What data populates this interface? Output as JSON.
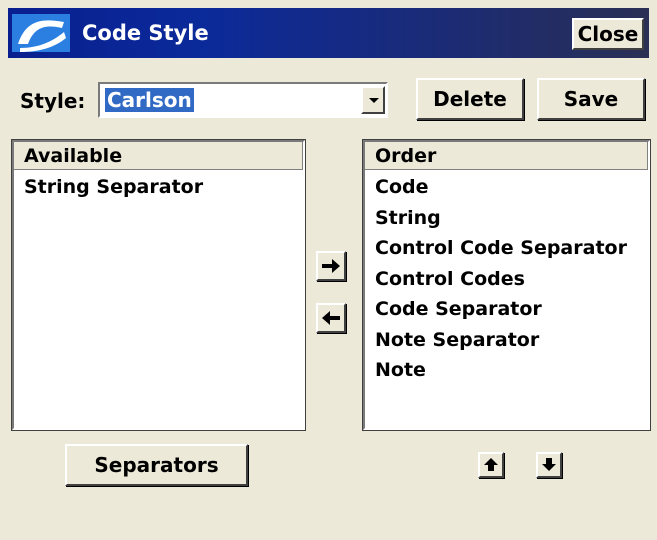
{
  "window": {
    "title": "Code Style",
    "close_label": "Close",
    "titlebar_color_start": "#0a1f8f",
    "titlebar_color_end": "#2a2f55"
  },
  "style_row": {
    "label": "Style:",
    "selected_value": "Carlson",
    "delete_label": "Delete",
    "save_label": "Save",
    "dropdown_icon": "chevron-down-icon"
  },
  "available": {
    "header": "Available",
    "items": [
      "String Separator"
    ]
  },
  "order": {
    "header": "Order",
    "items": [
      "Code",
      "String",
      "Control Code Separator",
      "Control Codes",
      "Code Separator",
      "Note Separator",
      "Note"
    ]
  },
  "controls": {
    "move_right_icon": "arrow-right-icon",
    "move_left_icon": "arrow-left-icon",
    "move_up_icon": "arrow-up-icon",
    "move_down_icon": "arrow-down-icon",
    "separators_label": "Separators"
  },
  "colors": {
    "dialog_bg": "#ece9d8",
    "selection_bg": "#316ac5"
  }
}
